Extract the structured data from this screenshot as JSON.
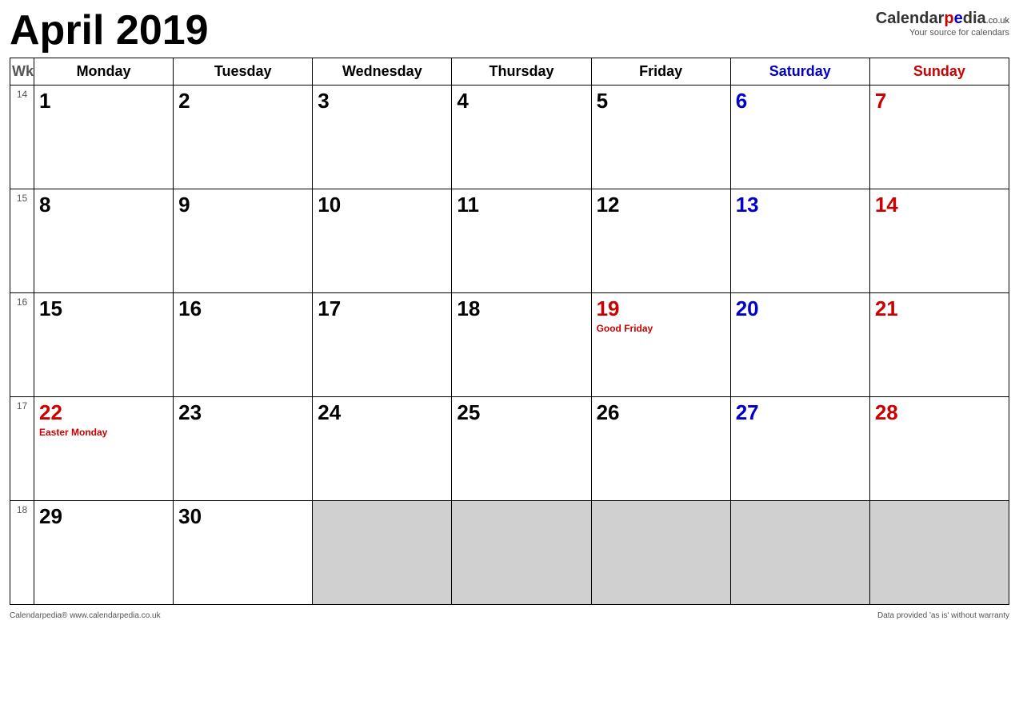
{
  "header": {
    "title": "April 2019",
    "logo_name": "Calendar",
    "logo_suffix": "pedia",
    "logo_tld": ".co.uk",
    "logo_tagline": "Your source for calendars"
  },
  "footer": {
    "left": "Calendarpedia®  www.calendarpedia.co.uk",
    "right": "Data provided 'as is' without warranty"
  },
  "columns": {
    "wk": "Wk",
    "mon": "Monday",
    "tue": "Tuesday",
    "wed": "Wednesday",
    "thu": "Thursday",
    "fri": "Friday",
    "sat": "Saturday",
    "sun": "Sunday"
  },
  "weeks": [
    {
      "wk": "14",
      "days": [
        {
          "num": "1",
          "type": "regular",
          "holiday": ""
        },
        {
          "num": "2",
          "type": "regular",
          "holiday": ""
        },
        {
          "num": "3",
          "type": "regular",
          "holiday": ""
        },
        {
          "num": "4",
          "type": "regular",
          "holiday": ""
        },
        {
          "num": "5",
          "type": "regular",
          "holiday": ""
        },
        {
          "num": "6",
          "type": "saturday",
          "holiday": ""
        },
        {
          "num": "7",
          "type": "sunday",
          "holiday": ""
        }
      ]
    },
    {
      "wk": "15",
      "days": [
        {
          "num": "8",
          "type": "regular",
          "holiday": ""
        },
        {
          "num": "9",
          "type": "regular",
          "holiday": ""
        },
        {
          "num": "10",
          "type": "regular",
          "holiday": ""
        },
        {
          "num": "11",
          "type": "regular",
          "holiday": ""
        },
        {
          "num": "12",
          "type": "regular",
          "holiday": ""
        },
        {
          "num": "13",
          "type": "saturday",
          "holiday": ""
        },
        {
          "num": "14",
          "type": "sunday",
          "holiday": ""
        }
      ]
    },
    {
      "wk": "16",
      "days": [
        {
          "num": "15",
          "type": "regular",
          "holiday": ""
        },
        {
          "num": "16",
          "type": "regular",
          "holiday": ""
        },
        {
          "num": "17",
          "type": "regular",
          "holiday": ""
        },
        {
          "num": "18",
          "type": "regular",
          "holiday": ""
        },
        {
          "num": "19",
          "type": "holiday",
          "holiday": "Good Friday"
        },
        {
          "num": "20",
          "type": "saturday",
          "holiday": ""
        },
        {
          "num": "21",
          "type": "sunday",
          "holiday": ""
        }
      ]
    },
    {
      "wk": "17",
      "days": [
        {
          "num": "22",
          "type": "holiday",
          "holiday": "Easter Monday"
        },
        {
          "num": "23",
          "type": "regular",
          "holiday": ""
        },
        {
          "num": "24",
          "type": "regular",
          "holiday": ""
        },
        {
          "num": "25",
          "type": "regular",
          "holiday": ""
        },
        {
          "num": "26",
          "type": "regular",
          "holiday": ""
        },
        {
          "num": "27",
          "type": "saturday",
          "holiday": ""
        },
        {
          "num": "28",
          "type": "sunday",
          "holiday": ""
        }
      ]
    },
    {
      "wk": "18",
      "days": [
        {
          "num": "29",
          "type": "regular",
          "holiday": ""
        },
        {
          "num": "30",
          "type": "regular",
          "holiday": ""
        },
        {
          "num": "",
          "type": "empty",
          "holiday": ""
        },
        {
          "num": "",
          "type": "empty",
          "holiday": ""
        },
        {
          "num": "",
          "type": "empty",
          "holiday": ""
        },
        {
          "num": "",
          "type": "empty",
          "holiday": ""
        },
        {
          "num": "",
          "type": "empty",
          "holiday": ""
        }
      ]
    }
  ]
}
